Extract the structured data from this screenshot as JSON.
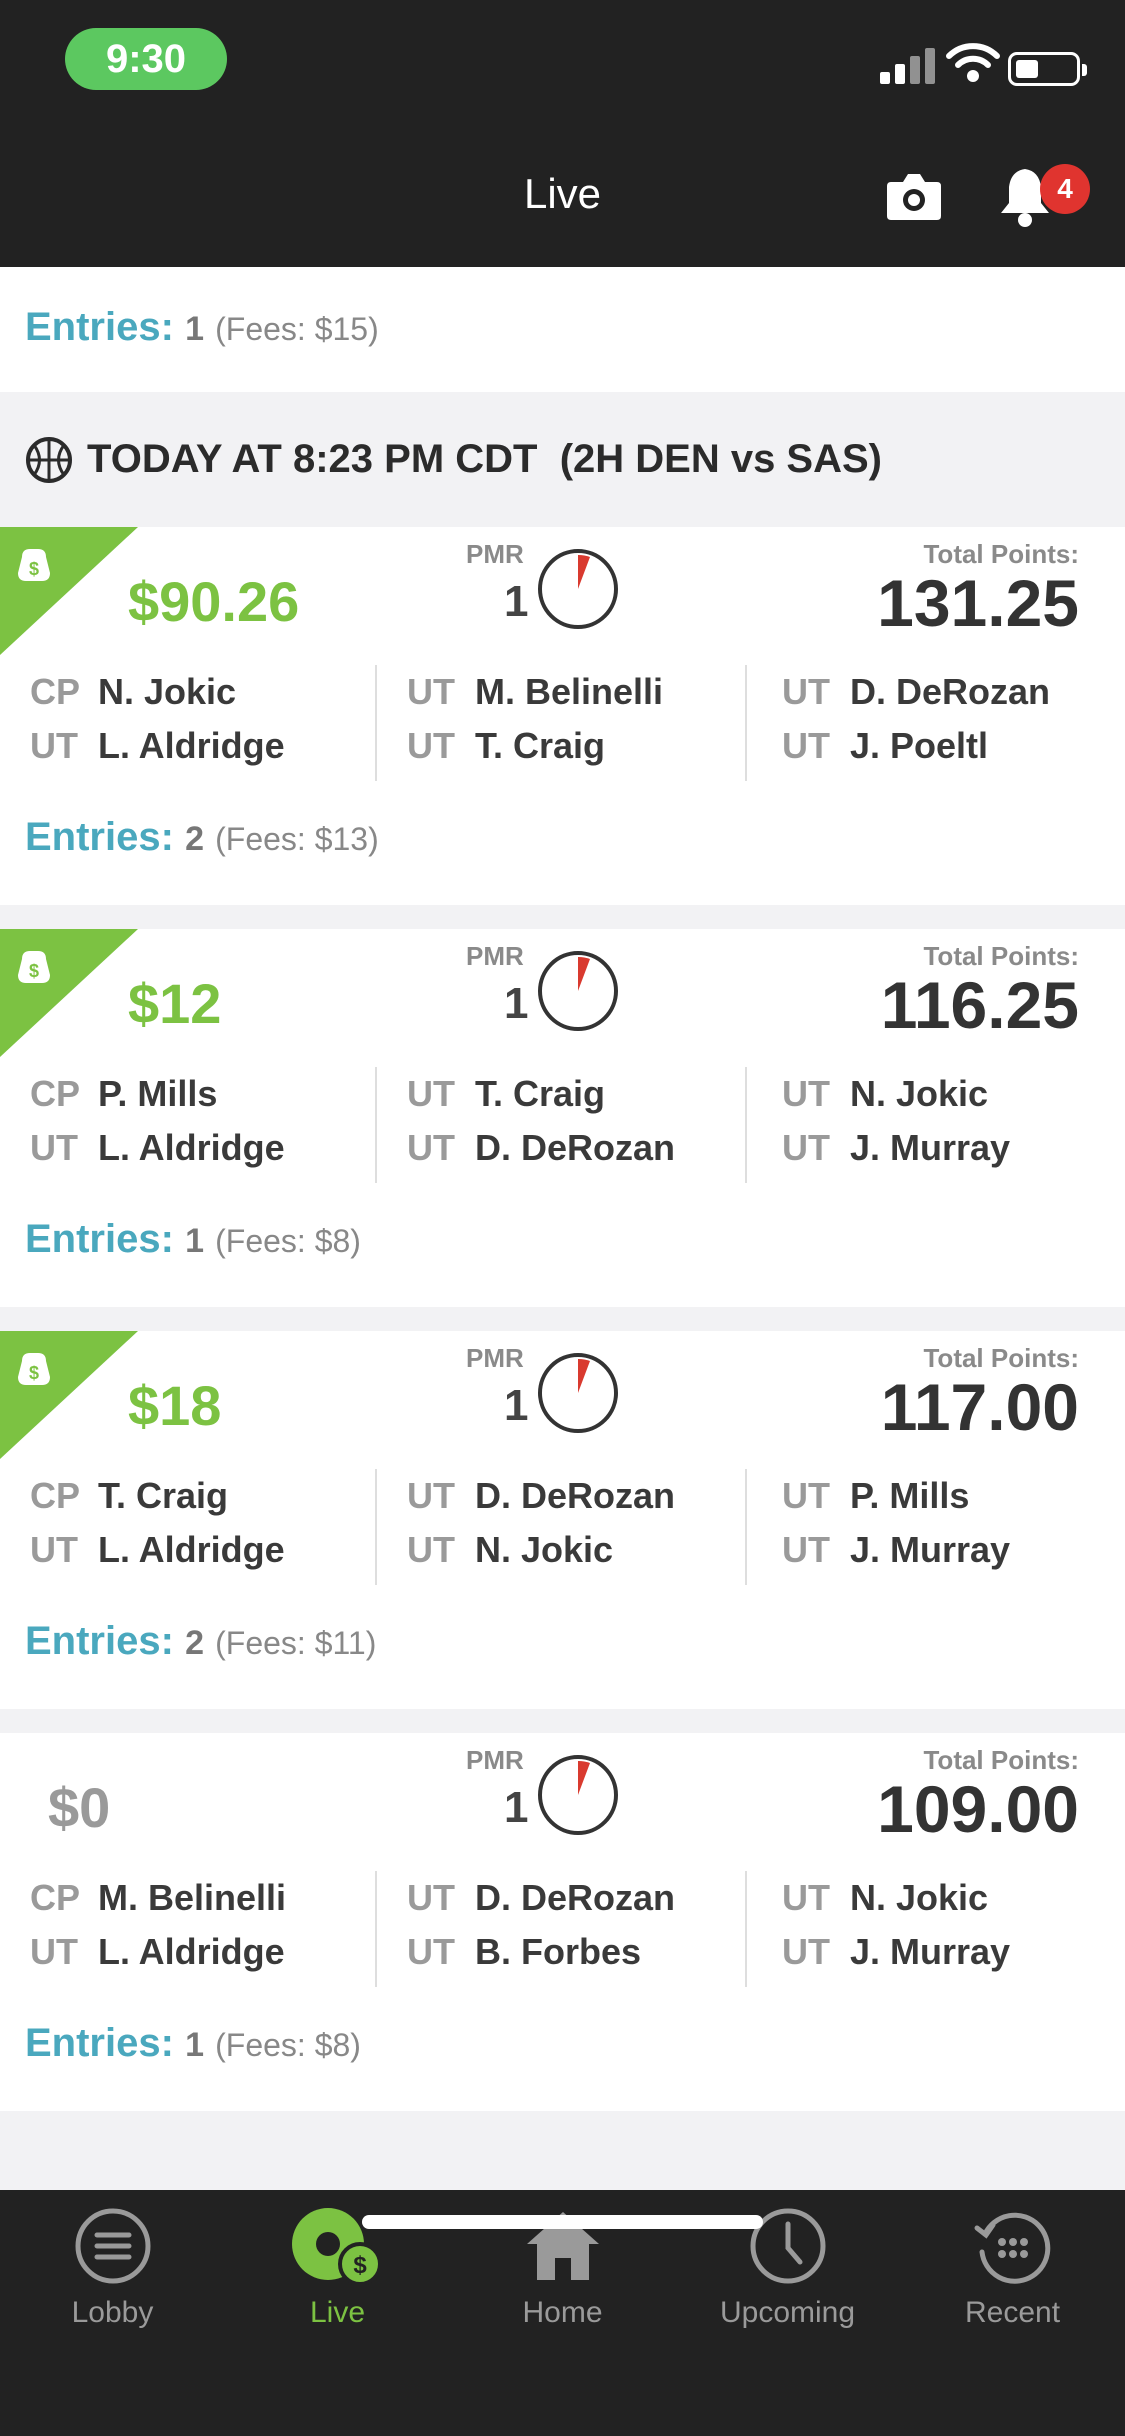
{
  "status_bar": {
    "time": "9:30"
  },
  "header": {
    "title": "Live",
    "notification_count": "4"
  },
  "top_entries": {
    "label": "Entries:",
    "count": "1",
    "fees": "(Fees: $15)"
  },
  "section": {
    "title": "TODAY AT 8:23 PM CDT  (2H DEN vs SAS)"
  },
  "cards": [
    {
      "winnings": "$90.26",
      "has_flag": true,
      "pmr_label": "PMR",
      "pmr": "1",
      "total_label": "Total Points:",
      "total": "131.25",
      "players": [
        {
          "pos": "CP",
          "name": "N. Jokic"
        },
        {
          "pos": "UT",
          "name": "L. Aldridge"
        },
        {
          "pos": "UT",
          "name": "M. Belinelli"
        },
        {
          "pos": "UT",
          "name": "T. Craig"
        },
        {
          "pos": "UT",
          "name": "D. DeRozan"
        },
        {
          "pos": "UT",
          "name": "J. Poeltl"
        }
      ],
      "entries_label": "Entries:",
      "entries": "2",
      "fees": "(Fees: $13)"
    },
    {
      "winnings": "$12",
      "has_flag": true,
      "pmr_label": "PMR",
      "pmr": "1",
      "total_label": "Total Points:",
      "total": "116.25",
      "players": [
        {
          "pos": "CP",
          "name": "P. Mills"
        },
        {
          "pos": "UT",
          "name": "L. Aldridge"
        },
        {
          "pos": "UT",
          "name": "T. Craig"
        },
        {
          "pos": "UT",
          "name": "D. DeRozan"
        },
        {
          "pos": "UT",
          "name": "N. Jokic"
        },
        {
          "pos": "UT",
          "name": "J. Murray"
        }
      ],
      "entries_label": "Entries:",
      "entries": "1",
      "fees": "(Fees: $8)"
    },
    {
      "winnings": "$18",
      "has_flag": true,
      "pmr_label": "PMR",
      "pmr": "1",
      "total_label": "Total Points:",
      "total": "117.00",
      "players": [
        {
          "pos": "CP",
          "name": "T. Craig"
        },
        {
          "pos": "UT",
          "name": "L. Aldridge"
        },
        {
          "pos": "UT",
          "name": "D. DeRozan"
        },
        {
          "pos": "UT",
          "name": "N. Jokic"
        },
        {
          "pos": "UT",
          "name": "P. Mills"
        },
        {
          "pos": "UT",
          "name": "J. Murray"
        }
      ],
      "entries_label": "Entries:",
      "entries": "2",
      "fees": "(Fees: $11)"
    },
    {
      "winnings": "$0",
      "has_flag": false,
      "pmr_label": "PMR",
      "pmr": "1",
      "total_label": "Total Points:",
      "total": "109.00",
      "players": [
        {
          "pos": "CP",
          "name": "M. Belinelli"
        },
        {
          "pos": "UT",
          "name": "L. Aldridge"
        },
        {
          "pos": "UT",
          "name": "D. DeRozan"
        },
        {
          "pos": "UT",
          "name": "B. Forbes"
        },
        {
          "pos": "UT",
          "name": "N. Jokic"
        },
        {
          "pos": "UT",
          "name": "J. Murray"
        }
      ],
      "entries_label": "Entries:",
      "entries": "1",
      "fees": "(Fees: $8)"
    }
  ],
  "tabs": [
    {
      "label": "Lobby",
      "icon": "menu-icon",
      "active": false
    },
    {
      "label": "Live",
      "icon": "live-money-icon",
      "active": true
    },
    {
      "label": "Home",
      "icon": "home-icon",
      "active": false
    },
    {
      "label": "Upcoming",
      "icon": "clock-icon",
      "active": false
    },
    {
      "label": "Recent",
      "icon": "history-icon",
      "active": false
    }
  ],
  "colors": {
    "accent_green": "#7cc242",
    "entries_blue": "#4aa8be",
    "badge_red": "#e0342f",
    "header_bg": "#222222"
  }
}
